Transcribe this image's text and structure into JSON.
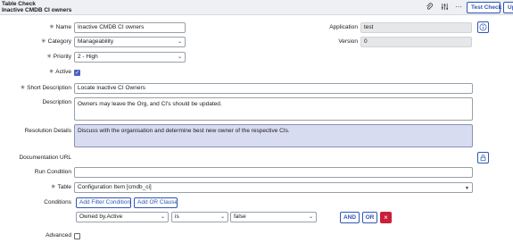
{
  "header": {
    "title": "Table Check",
    "subtitle": "Inactive CMDB CI owners",
    "test_check_label": "Test Check",
    "update_label": "Up"
  },
  "form": {
    "name": {
      "label": "Name",
      "value": "Inactive CMDB CI owners"
    },
    "category": {
      "label": "Category",
      "value": "Manageability"
    },
    "priority": {
      "label": "Priority",
      "value": "2 - High"
    },
    "active": {
      "label": "Active",
      "checked": true
    },
    "application": {
      "label": "Application",
      "value": "test"
    },
    "version": {
      "label": "Version",
      "value": "0"
    },
    "short_description": {
      "label": "Short Description",
      "value": "Locate inactive CI Owners"
    },
    "description": {
      "label": "Description",
      "value": "Owners may leave the Org, and CI's should be updated."
    },
    "resolution_details": {
      "label": "Resolution Details",
      "value": "Discuss with the organisation and determine best new owner of the respective CIs."
    },
    "documentation_url": {
      "label": "Documentation URL",
      "value": ""
    },
    "run_condition": {
      "label": "Run Condition",
      "value": ""
    },
    "table": {
      "label": "Table",
      "value": "Configuration Item [cmdb_ci]"
    },
    "conditions": {
      "label": "Conditions",
      "add_filter_label": "Add Filter Condition",
      "add_or_label": "Add OR Clause",
      "field": "Owned by.Active",
      "operator": "is",
      "value": "false",
      "and_label": "AND",
      "or_label": "OR"
    },
    "advanced": {
      "label": "Advanced",
      "checked": false
    }
  },
  "colors": {
    "accent": "#2f56b6",
    "delete": "#c8203a",
    "highlight_field": "#d8dcf0"
  },
  "icons": [
    "paperclip-icon",
    "sliders-icon",
    "more-icon",
    "info-icon",
    "lock-icon",
    "delete-icon",
    "check-icon"
  ]
}
